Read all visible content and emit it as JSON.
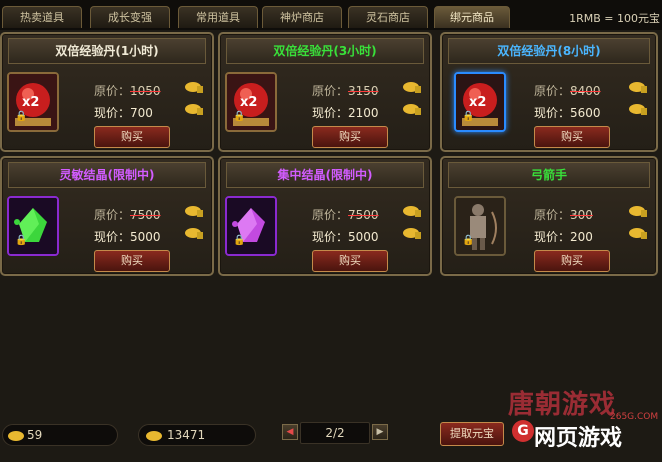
{
  "tabs": [
    {
      "label": "热卖道具"
    },
    {
      "label": "成长变强"
    },
    {
      "label": "常用道具"
    },
    {
      "label": "神炉商店"
    },
    {
      "label": "灵石商店"
    },
    {
      "label": "绑元商品"
    }
  ],
  "rate": "1RMB = 100元宝",
  "labels": {
    "orig_prefix": "原价：",
    "now_prefix": "现价：",
    "buy": "购买"
  },
  "items": [
    {
      "name": "双倍经验丹(1小时)",
      "orig": "1050",
      "now": "700",
      "icon": "exp-pill-icon"
    },
    {
      "name": "双倍经验丹(3小时)",
      "orig": "3150",
      "now": "2100",
      "icon": "exp-pill-icon"
    },
    {
      "name": "双倍经验丹(8小时)",
      "orig": "8400",
      "now": "5600",
      "icon": "exp-pill-icon"
    },
    {
      "name": "灵敏结晶(限制中)",
      "orig": "7500",
      "now": "5000",
      "icon": "green-crystal-icon"
    },
    {
      "name": "集中结晶(限制中)",
      "orig": "7500",
      "now": "5000",
      "icon": "purple-crystal-icon"
    },
    {
      "name": "弓箭手",
      "orig": "300",
      "now": "200",
      "icon": "archer-icon"
    }
  ],
  "bottom": {
    "balance1": "59",
    "balance2": "13471",
    "page": "2/2",
    "withdraw": "提取元宝"
  },
  "watermark": {
    "text1": "唐朝游戏",
    "text2": "网页游戏",
    "text3": "265G.COM",
    "g": "G"
  },
  "colors": {
    "green": "#39e03a",
    "blue": "#4ab6ff",
    "purple": "#d25cff",
    "strike": "#ff3b3b"
  }
}
